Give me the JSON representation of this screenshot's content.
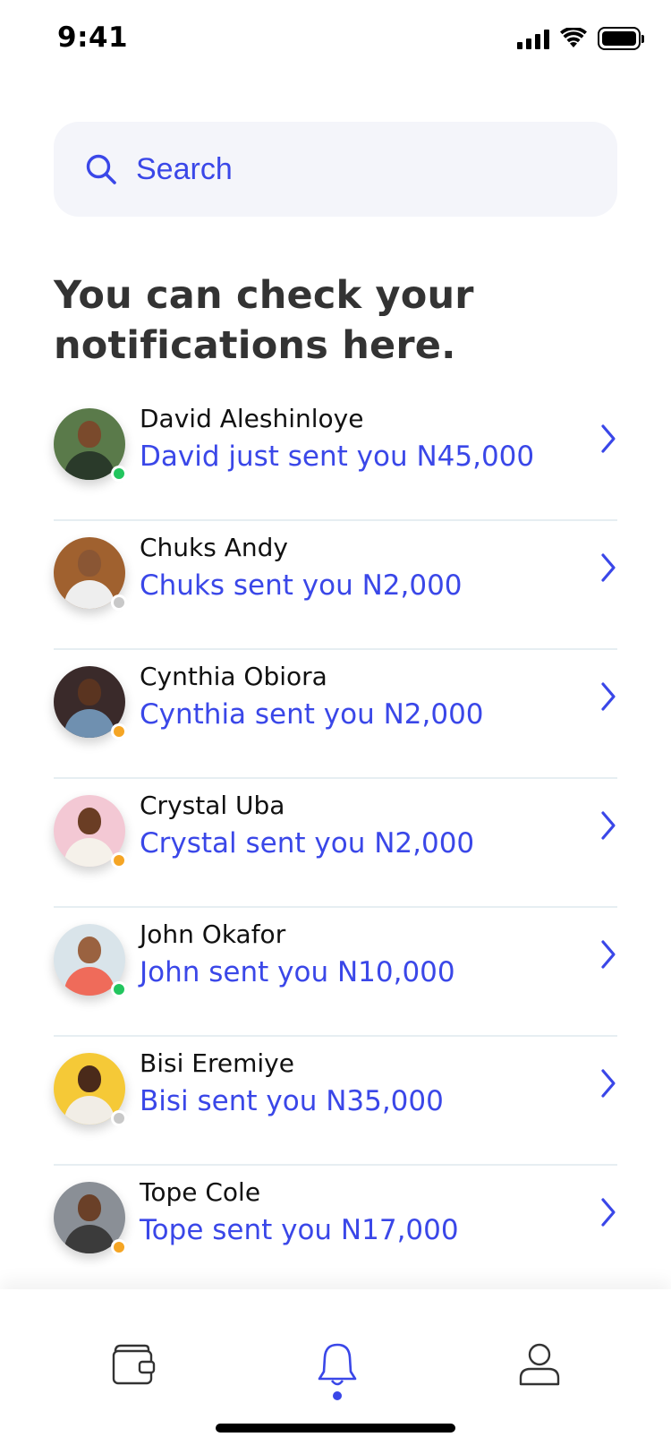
{
  "status_bar": {
    "time": "9:41"
  },
  "search": {
    "placeholder": "Search"
  },
  "heading": {
    "text": "You can check your notifications here."
  },
  "colors": {
    "accent": "#3a47e8",
    "online": "#22c55e",
    "away": "#f5a524",
    "offline": "#c8c8c8"
  },
  "notifications": [
    {
      "name": "David Aleshinloye",
      "message": "David just sent you N45,000",
      "status": "online",
      "avatar_bg": "#5a7a4a",
      "skin": "#7a4a2c",
      "shirt": "#2a3a2a"
    },
    {
      "name": "Chuks Andy",
      "message": "Chuks sent you N2,000",
      "status": "offline",
      "avatar_bg": "#a0612f",
      "skin": "#8a5634",
      "shirt": "#eeeeee"
    },
    {
      "name": "Cynthia Obiora",
      "message": "Cynthia sent you N2,000",
      "status": "away",
      "avatar_bg": "#3a2a2a",
      "skin": "#5a3420",
      "shirt": "#6f90b0"
    },
    {
      "name": "Crystal Uba",
      "message": "Crystal sent you N2,000",
      "status": "away",
      "avatar_bg": "#f3c8d4",
      "skin": "#6a3d24",
      "shirt": "#f5f1ea"
    },
    {
      "name": "John Okafor",
      "message": "John sent you N10,000",
      "status": "online",
      "avatar_bg": "#d9e4ea",
      "skin": "#9a6240",
      "shirt": "#ef6b5a"
    },
    {
      "name": "Bisi Eremiye",
      "message": "Bisi sent you N35,000",
      "status": "offline",
      "avatar_bg": "#f5c937",
      "skin": "#4a2a1a",
      "shirt": "#f1ede6"
    },
    {
      "name": "Tope Cole",
      "message": "Tope sent you N17,000",
      "status": "away",
      "avatar_bg": "#8a8f96",
      "skin": "#6a4028",
      "shirt": "#3b3b3b"
    }
  ],
  "nav": {
    "items": [
      {
        "icon": "wallet-icon",
        "active": false
      },
      {
        "icon": "bell-icon",
        "active": true
      },
      {
        "icon": "user-icon",
        "active": false
      }
    ]
  }
}
